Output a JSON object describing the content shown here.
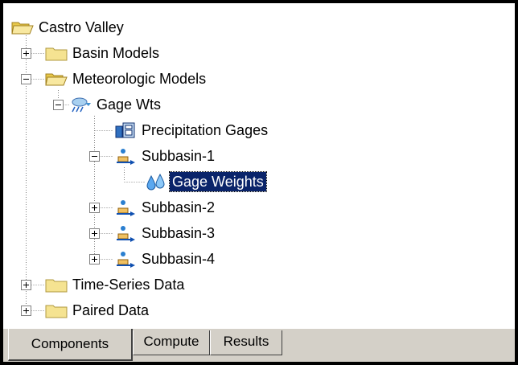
{
  "tree": {
    "root": {
      "label": "Castro Valley",
      "icon": "folder-open-icon"
    },
    "items": [
      {
        "label": "Basin Models",
        "icon": "folder-icon",
        "expander": "+"
      },
      {
        "label": "Meteorologic Models",
        "icon": "folder-open-icon",
        "expander": "-"
      },
      {
        "label": "Gage Wts",
        "icon": "meteorologic-model-icon",
        "expander": "-"
      },
      {
        "label": "Precipitation Gages",
        "icon": "precipitation-gages-icon"
      },
      {
        "label": "Subbasin-1",
        "icon": "subbasin-icon",
        "expander": "-"
      },
      {
        "label": "Gage Weights",
        "icon": "gage-weights-icon",
        "selected": true
      },
      {
        "label": "Subbasin-2",
        "icon": "subbasin-icon",
        "expander": "+"
      },
      {
        "label": "Subbasin-3",
        "icon": "subbasin-icon",
        "expander": "+"
      },
      {
        "label": "Subbasin-4",
        "icon": "subbasin-icon",
        "expander": "+"
      },
      {
        "label": "Time-Series Data",
        "icon": "folder-icon",
        "expander": "+"
      },
      {
        "label": "Paired Data",
        "icon": "folder-icon",
        "expander": "+"
      }
    ]
  },
  "tabs": [
    {
      "label": "Components",
      "active": true
    },
    {
      "label": "Compute",
      "active": false
    },
    {
      "label": "Results",
      "active": false
    }
  ],
  "colors": {
    "selection": "#0a246a",
    "folder": "#f5e391",
    "tab_bg": "#d4d0c8"
  }
}
